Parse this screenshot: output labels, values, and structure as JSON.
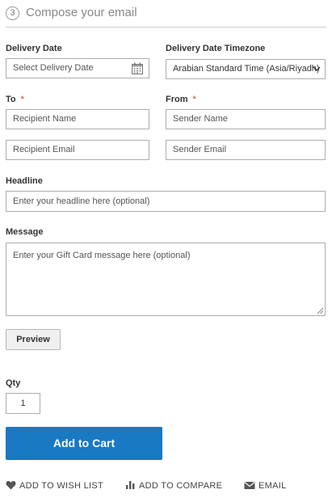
{
  "step": {
    "number": "3",
    "title": "Compose your email"
  },
  "delivery": {
    "date_label": "Delivery Date",
    "date_placeholder": "Select Delivery Date",
    "timezone_label": "Delivery Date Timezone",
    "timezone_value": "Arabian Standard Time (Asia/Riyadh)"
  },
  "to": {
    "label": "To",
    "required_mark": "*",
    "name_placeholder": "Recipient Name",
    "email_placeholder": "Recipient Email"
  },
  "from": {
    "label": "From",
    "required_mark": "*",
    "name_placeholder": "Sender Name",
    "email_placeholder": "Sender Email"
  },
  "headline": {
    "label": "Headline",
    "placeholder": "Enter your headline here (optional)"
  },
  "message": {
    "label": "Message",
    "placeholder": "Enter your Gift Card message here (optional)"
  },
  "preview_label": "Preview",
  "qty": {
    "label": "Qty",
    "value": "1"
  },
  "add_to_cart_label": "Add to Cart",
  "actions": {
    "wishlist": "ADD TO WISH LIST",
    "compare": "ADD TO COMPARE",
    "email": "EMAIL"
  },
  "colors": {
    "primary": "#1979c3",
    "required": "#e02b27"
  }
}
